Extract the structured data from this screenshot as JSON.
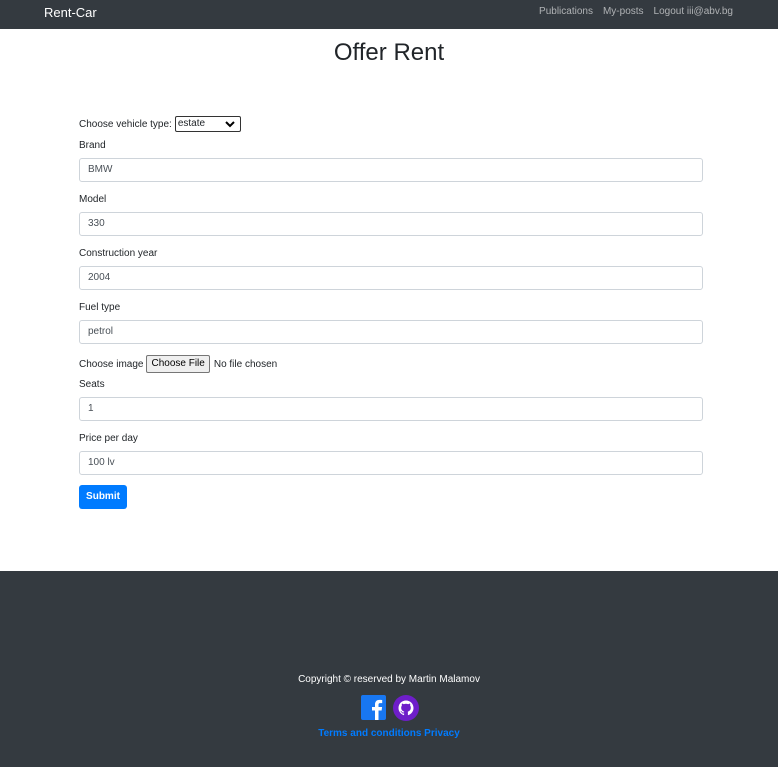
{
  "navbar": {
    "brand": "Rent-Car",
    "links": [
      "Publications",
      "My-posts",
      "Logout iii@abv.bg"
    ]
  },
  "page": {
    "title": "Offer Rent"
  },
  "form": {
    "vehicle_type_label": "Choose vehicle type:",
    "vehicle_type_value": "estate",
    "brand": {
      "label": "Brand",
      "value": "BMW"
    },
    "model": {
      "label": "Model",
      "value": "330"
    },
    "year": {
      "label": "Construction year",
      "value": "2004"
    },
    "fuel": {
      "label": "Fuel type",
      "value": "petrol"
    },
    "image_label": "Choose image",
    "file_button": "Choose File",
    "file_status": "No file chosen",
    "seats": {
      "label": "Seats",
      "value": "1"
    },
    "price": {
      "label": "Price per day",
      "value": "100 lv"
    },
    "submit": "Submit"
  },
  "footer": {
    "copyright": "Copyright © reserved by Martin Malamov",
    "icons": [
      "facebook-icon",
      "github-icon"
    ],
    "terms_link": "Terms and conditions",
    "privacy_link": "Privacy"
  },
  "colors": {
    "navbar_bg": "#343a40",
    "primary": "#007bff",
    "facebook": "#1877f2",
    "github": "#6e1ec9"
  }
}
